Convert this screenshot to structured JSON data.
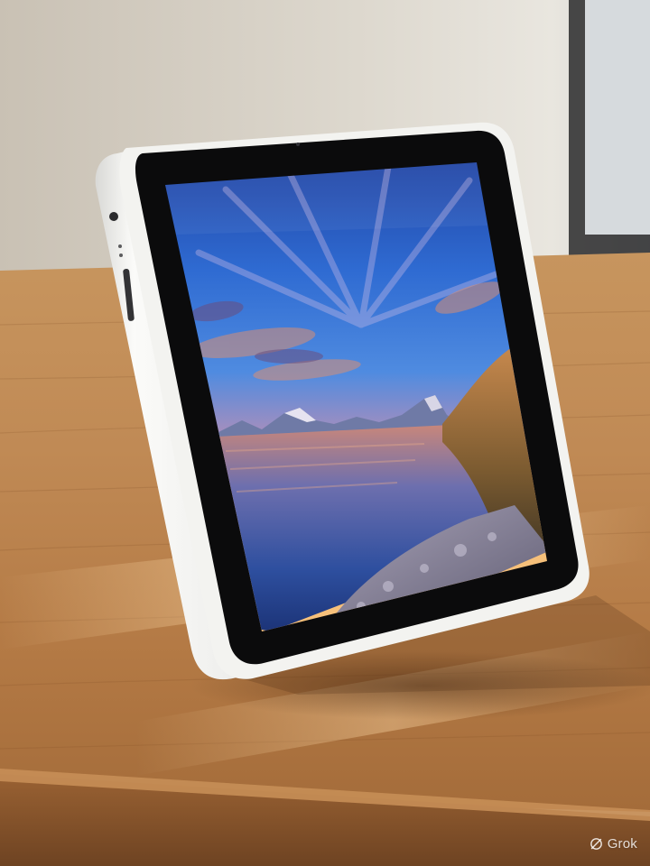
{
  "watermark": {
    "label": "Grok",
    "icon": "grok-logo-icon"
  },
  "colors": {
    "wall": "#d8d2c6",
    "table_wood": "#b98552",
    "device_body": "#f1f1ee",
    "bezel": "#0b0b0c",
    "sky_top": "#2f63c8",
    "sunset_glow": "#f0a25d",
    "water": "#2c4e9a"
  }
}
